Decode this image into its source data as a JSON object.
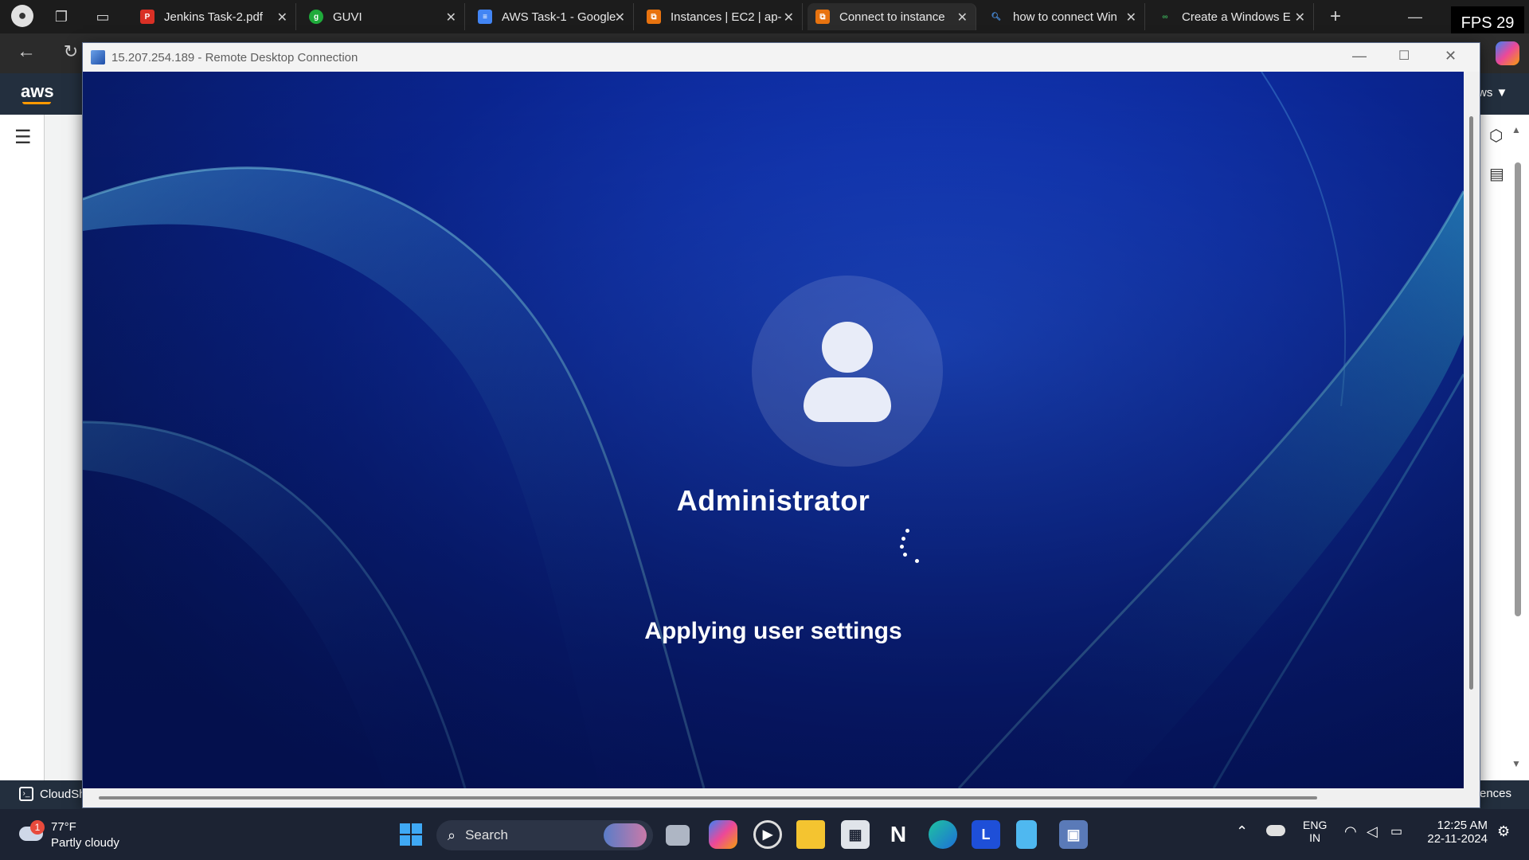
{
  "browser": {
    "tabs": [
      {
        "title": "Jenkins Task-2.pdf",
        "icon": "pdf-icon",
        "icon_color": "#d93025"
      },
      {
        "title": "GUVI",
        "icon": "guvi-icon",
        "icon_color": "#1fab3b"
      },
      {
        "title": "AWS Task-1 - Google",
        "icon": "google-docs-icon",
        "icon_color": "#4285f4"
      },
      {
        "title": "Instances | EC2 | ap-",
        "icon": "aws-ec2-icon",
        "icon_color": "#e8730f"
      },
      {
        "title": "Connect to instance",
        "icon": "aws-ec2-icon",
        "icon_color": "#e8730f"
      },
      {
        "title": "how to connect Win",
        "icon": "search-icon",
        "icon_color": "#4a90e2"
      },
      {
        "title": "Create a Windows E",
        "icon": "link-icon",
        "icon_color": "#3aa757"
      }
    ],
    "active_tab_index": 4,
    "fps_label": "FPS 29"
  },
  "aws": {
    "logo": "aws",
    "right_text": "ws ▼",
    "cloudshell_label": "CloudSh",
    "footer_right": "ences"
  },
  "rdp": {
    "title": "15.207.254.189 - Remote Desktop Connection",
    "username": "Administrator",
    "status": "Applying user settings"
  },
  "taskbar": {
    "weather_temp": "77°F",
    "weather_desc": "Partly cloudy",
    "weather_badge": "1",
    "search_placeholder": "Search",
    "lang_primary": "ENG",
    "lang_secondary": "IN",
    "time": "12:25 AM",
    "date": "22-11-2024"
  },
  "colors": {
    "accent_blue": "#1f4fd8",
    "aws_nav": "#232f3e",
    "taskbar": "#1c2333"
  }
}
